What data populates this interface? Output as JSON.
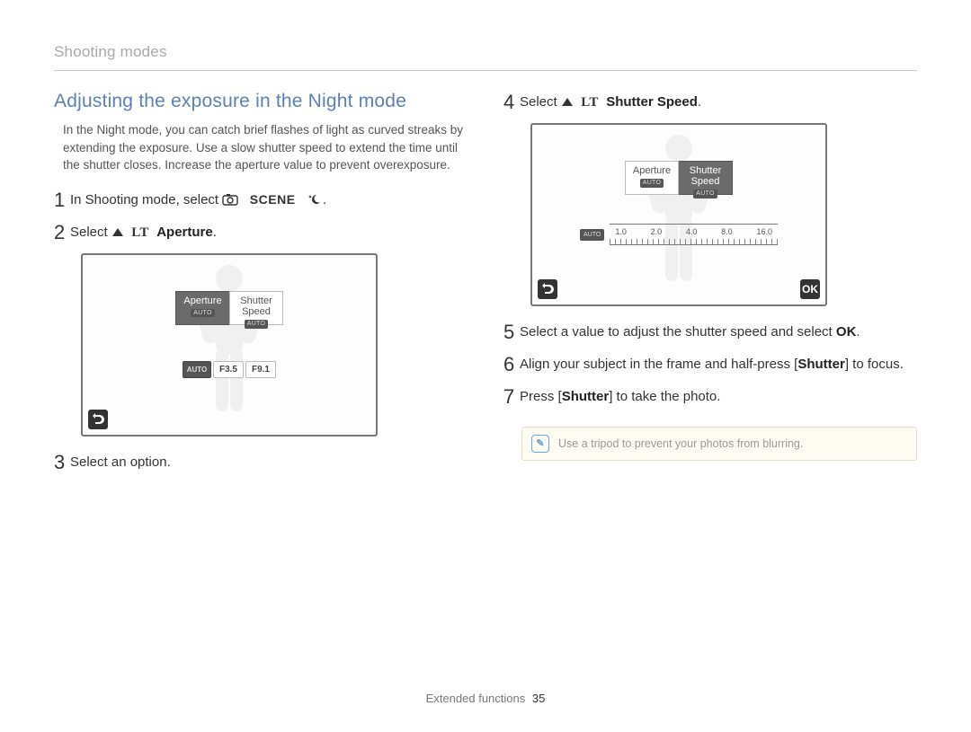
{
  "sectionHeader": "Shooting modes",
  "heading": "Adjusting the exposure in the Night mode",
  "intro": "In the Night mode, you can catch brief flashes of light as curved streaks by extending the exposure. Use a slow shutter speed to extend the time until the shutter closes. Increase the aperture value to prevent overexposure.",
  "steps": {
    "s1_a": "In Shooting mode, select",
    "s1_scene": "SCENE",
    "s2_a": "Select",
    "s2_lt": "LT",
    "s2_bold": "Aperture",
    "s3": "Select an option.",
    "s4_a": "Select",
    "s4_lt": "LT",
    "s4_bold": "Shutter Speed",
    "s5_a": "Select a value to adjust the shutter speed and select",
    "s5_ok": "OK",
    "s6_a": "Align your subject in the frame and half-press [",
    "s6_b": "Shutter",
    "s6_c": "] to focus.",
    "s7_a": "Press [",
    "s7_b": "Shutter",
    "s7_c": "] to take the photo."
  },
  "figure1": {
    "tabLeft": "Aperture",
    "tabRight1": "Shutter",
    "tabRight2": "Speed",
    "auto": "AUTO",
    "values": [
      "F3.5",
      "F9.1"
    ]
  },
  "figure2": {
    "tabLeft": "Aperture",
    "tabRight1": "Shutter",
    "tabRight2": "Speed",
    "auto": "AUTO",
    "ticks": [
      "1.0",
      "2.0",
      "4.0",
      "8.0",
      "16.0"
    ],
    "okLabel": "OK"
  },
  "noteText": "Use a tripod to prevent your photos from blurring.",
  "footerLabel": "Extended functions",
  "footerPage": "35"
}
